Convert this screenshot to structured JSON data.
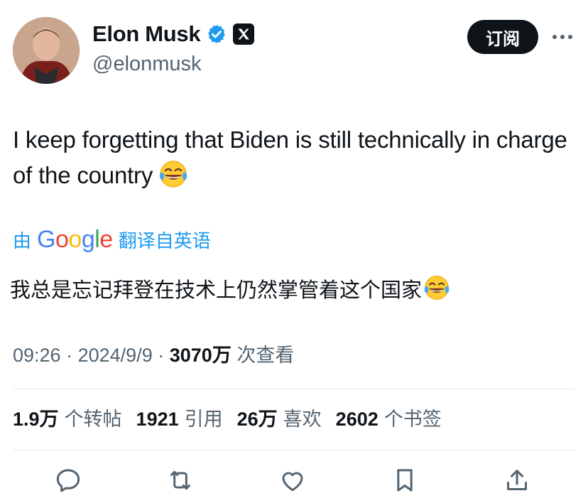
{
  "author": {
    "display_name": "Elon Musk",
    "handle": "@elonmusk"
  },
  "subscribe_label": "订阅",
  "tweet": {
    "text": "I keep forgetting that Biden is still technically in charge of the country",
    "emoji": "face-with-tears-of-joy"
  },
  "translation": {
    "prefix": "由",
    "provider": "Google",
    "suffix": "翻译自英语",
    "text": "我总是忘记拜登在技术上仍然掌管着这个国家"
  },
  "meta": {
    "time": "09:26",
    "sep1": "·",
    "date": "2024/9/9",
    "sep2": "·",
    "views_count": "3070万",
    "views_label": "次查看"
  },
  "stats": [
    {
      "count": "1.9万",
      "label": "个转帖"
    },
    {
      "count": "1921",
      "label": "引用"
    },
    {
      "count": "26万",
      "label": "喜欢"
    },
    {
      "count": "2602",
      "label": "个书签"
    }
  ],
  "colors": {
    "text": "#0f1419",
    "secondary": "#536471",
    "link": "#1d9bf0",
    "verified": "#1d9bf0",
    "divider": "#e1e6ea"
  }
}
